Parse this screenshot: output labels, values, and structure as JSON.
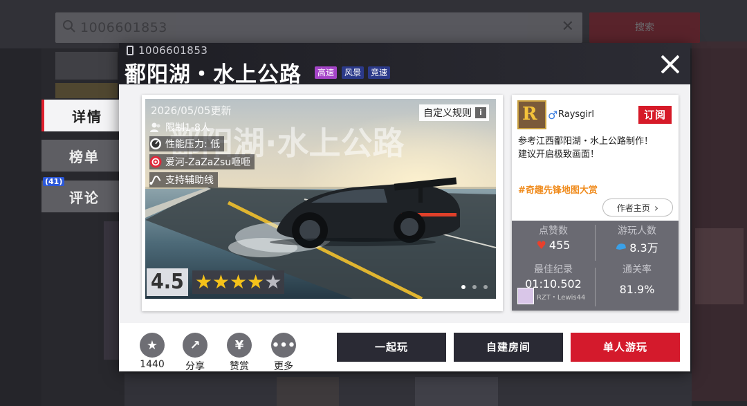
{
  "background": {
    "search_value": "1006601853",
    "search_button": "搜索"
  },
  "sidebar": {
    "items": [
      {
        "label": "详情",
        "active": true
      },
      {
        "label": "榜单",
        "active": false
      },
      {
        "label": "评论",
        "active": false,
        "badge": "(41)"
      }
    ]
  },
  "map": {
    "id": "1006601853",
    "title": "鄱阳湖・水上公路",
    "tags": [
      {
        "label": "高速",
        "color": "#a545c8"
      },
      {
        "label": "风景",
        "color": "#2c3a8a"
      },
      {
        "label": "竞速",
        "color": "#2c3a8a"
      }
    ],
    "image_title": "鄱阳湖·水上公路",
    "update_date": "2026/05/05更新",
    "player_limit": "限制1-8人",
    "performance_pressure": "性能压力: 低",
    "creator_tag": "爱河-ZaZaZsu咂咂",
    "assist_line": "支持辅助线",
    "custom_rule_label": "自定义规则",
    "rating": "4.5",
    "stars_full": 4,
    "stars_total": 5,
    "carousel_pages": 3,
    "carousel_active": 0
  },
  "author": {
    "name": "Raysgirl",
    "subscribe_label": "订阅",
    "desc_line1": "参考江西鄱阳湖・水上公路制作！",
    "desc_line2": "建议开启极致画面！",
    "hashtag": "#奇趣先锋地图大赏",
    "home_label": "作者主页"
  },
  "stats": {
    "likes_label": "点赞数",
    "likes_value": "455",
    "players_label": "游玩人数",
    "players_value": "8.3万",
    "best_label": "最佳纪录",
    "best_value": "01:10.502",
    "best_user": "RZT・Lewis44",
    "pass_label": "通关率",
    "pass_value": "81.9%"
  },
  "footer": {
    "favorite_count": "1440",
    "share_label": "分享",
    "reward_label": "赞赏",
    "more_label": "更多",
    "play_together": "一起玩",
    "create_room": "自建房间",
    "single_play": "单人游玩"
  },
  "colors": {
    "accent_red": "#d41a2c",
    "dark_button": "#2a2a34",
    "tag_orange": "#f08c1e"
  }
}
